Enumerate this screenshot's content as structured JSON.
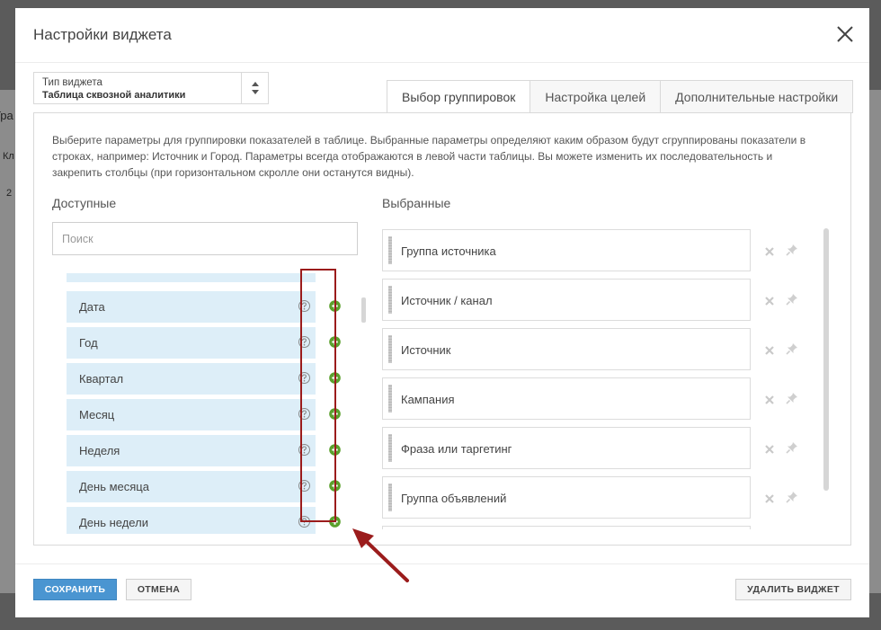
{
  "background": {
    "fragments": [
      "Гра",
      "Кл",
      "2"
    ]
  },
  "dialog": {
    "title": "Настройки виджета",
    "widget_type": {
      "label": "Тип виджета",
      "value": "Таблица сквозной аналитики"
    },
    "tabs": [
      {
        "label": "Выбор группировок",
        "active": true
      },
      {
        "label": "Настройка целей",
        "active": false
      },
      {
        "label": "Дополнительные настройки",
        "active": false
      }
    ],
    "description": "Выберите параметры для группировки показателей в таблице. Выбранные параметры определяют каким образом будут сгруппированы показатели в строках, например: Источник и Город. Параметры всегда отображаются в левой части таблицы. Вы можете изменить их последовательность и закрепить столбцы (при горизонтальном скролле они останутся видны).",
    "available": {
      "title": "Доступные",
      "search_placeholder": "Поиск",
      "items": [
        "Дата",
        "Год",
        "Квартал",
        "Месяц",
        "Неделя",
        "День месяца",
        "День недели"
      ]
    },
    "selected": {
      "title": "Выбранные",
      "items": [
        "Группа источника",
        "Источник / канал",
        "Источник",
        "Кампания",
        "Фраза или таргетинг",
        "Группа объявлений"
      ]
    },
    "buttons": {
      "save": "СОХРАНИТЬ",
      "cancel": "ОТМЕНА",
      "delete": "УДАЛИТЬ ВИДЖЕТ"
    }
  },
  "colors": {
    "accent": "#4a95d1",
    "add_icon": "#5aa02c",
    "item_bg": "#ddeef8",
    "highlight": "#9b1c1c"
  }
}
